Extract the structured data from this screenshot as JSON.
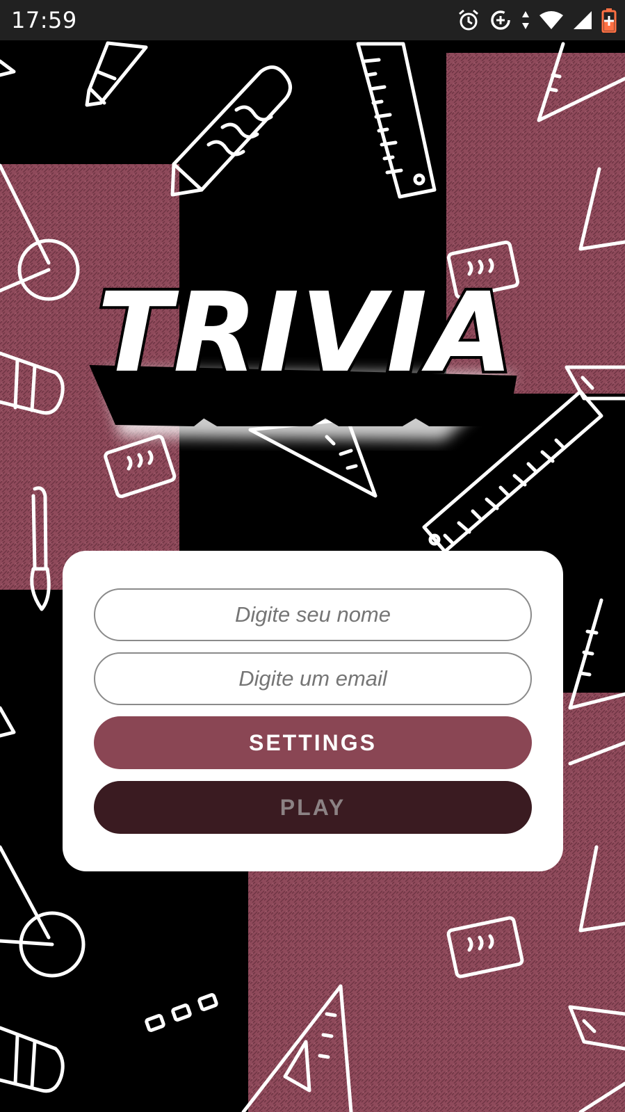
{
  "status_bar": {
    "time": "17:59",
    "icons": [
      "alarm-icon",
      "data-saver-icon",
      "data-arrows-icon",
      "wifi-icon",
      "signal-icon",
      "battery-charging-icon"
    ]
  },
  "logo": {
    "text": "TRIVIA"
  },
  "form": {
    "name_placeholder": "Digite seu nome",
    "email_placeholder": "Digite um email",
    "settings_label": "SETTINGS",
    "play_label": "PLAY"
  },
  "colors": {
    "status_bar": "#212121",
    "background_dark": "#000000",
    "background_pink": "#8f4a5b",
    "settings_button": "#8a4654",
    "play_button": "#3a1b21",
    "play_label": "#8c8284"
  }
}
